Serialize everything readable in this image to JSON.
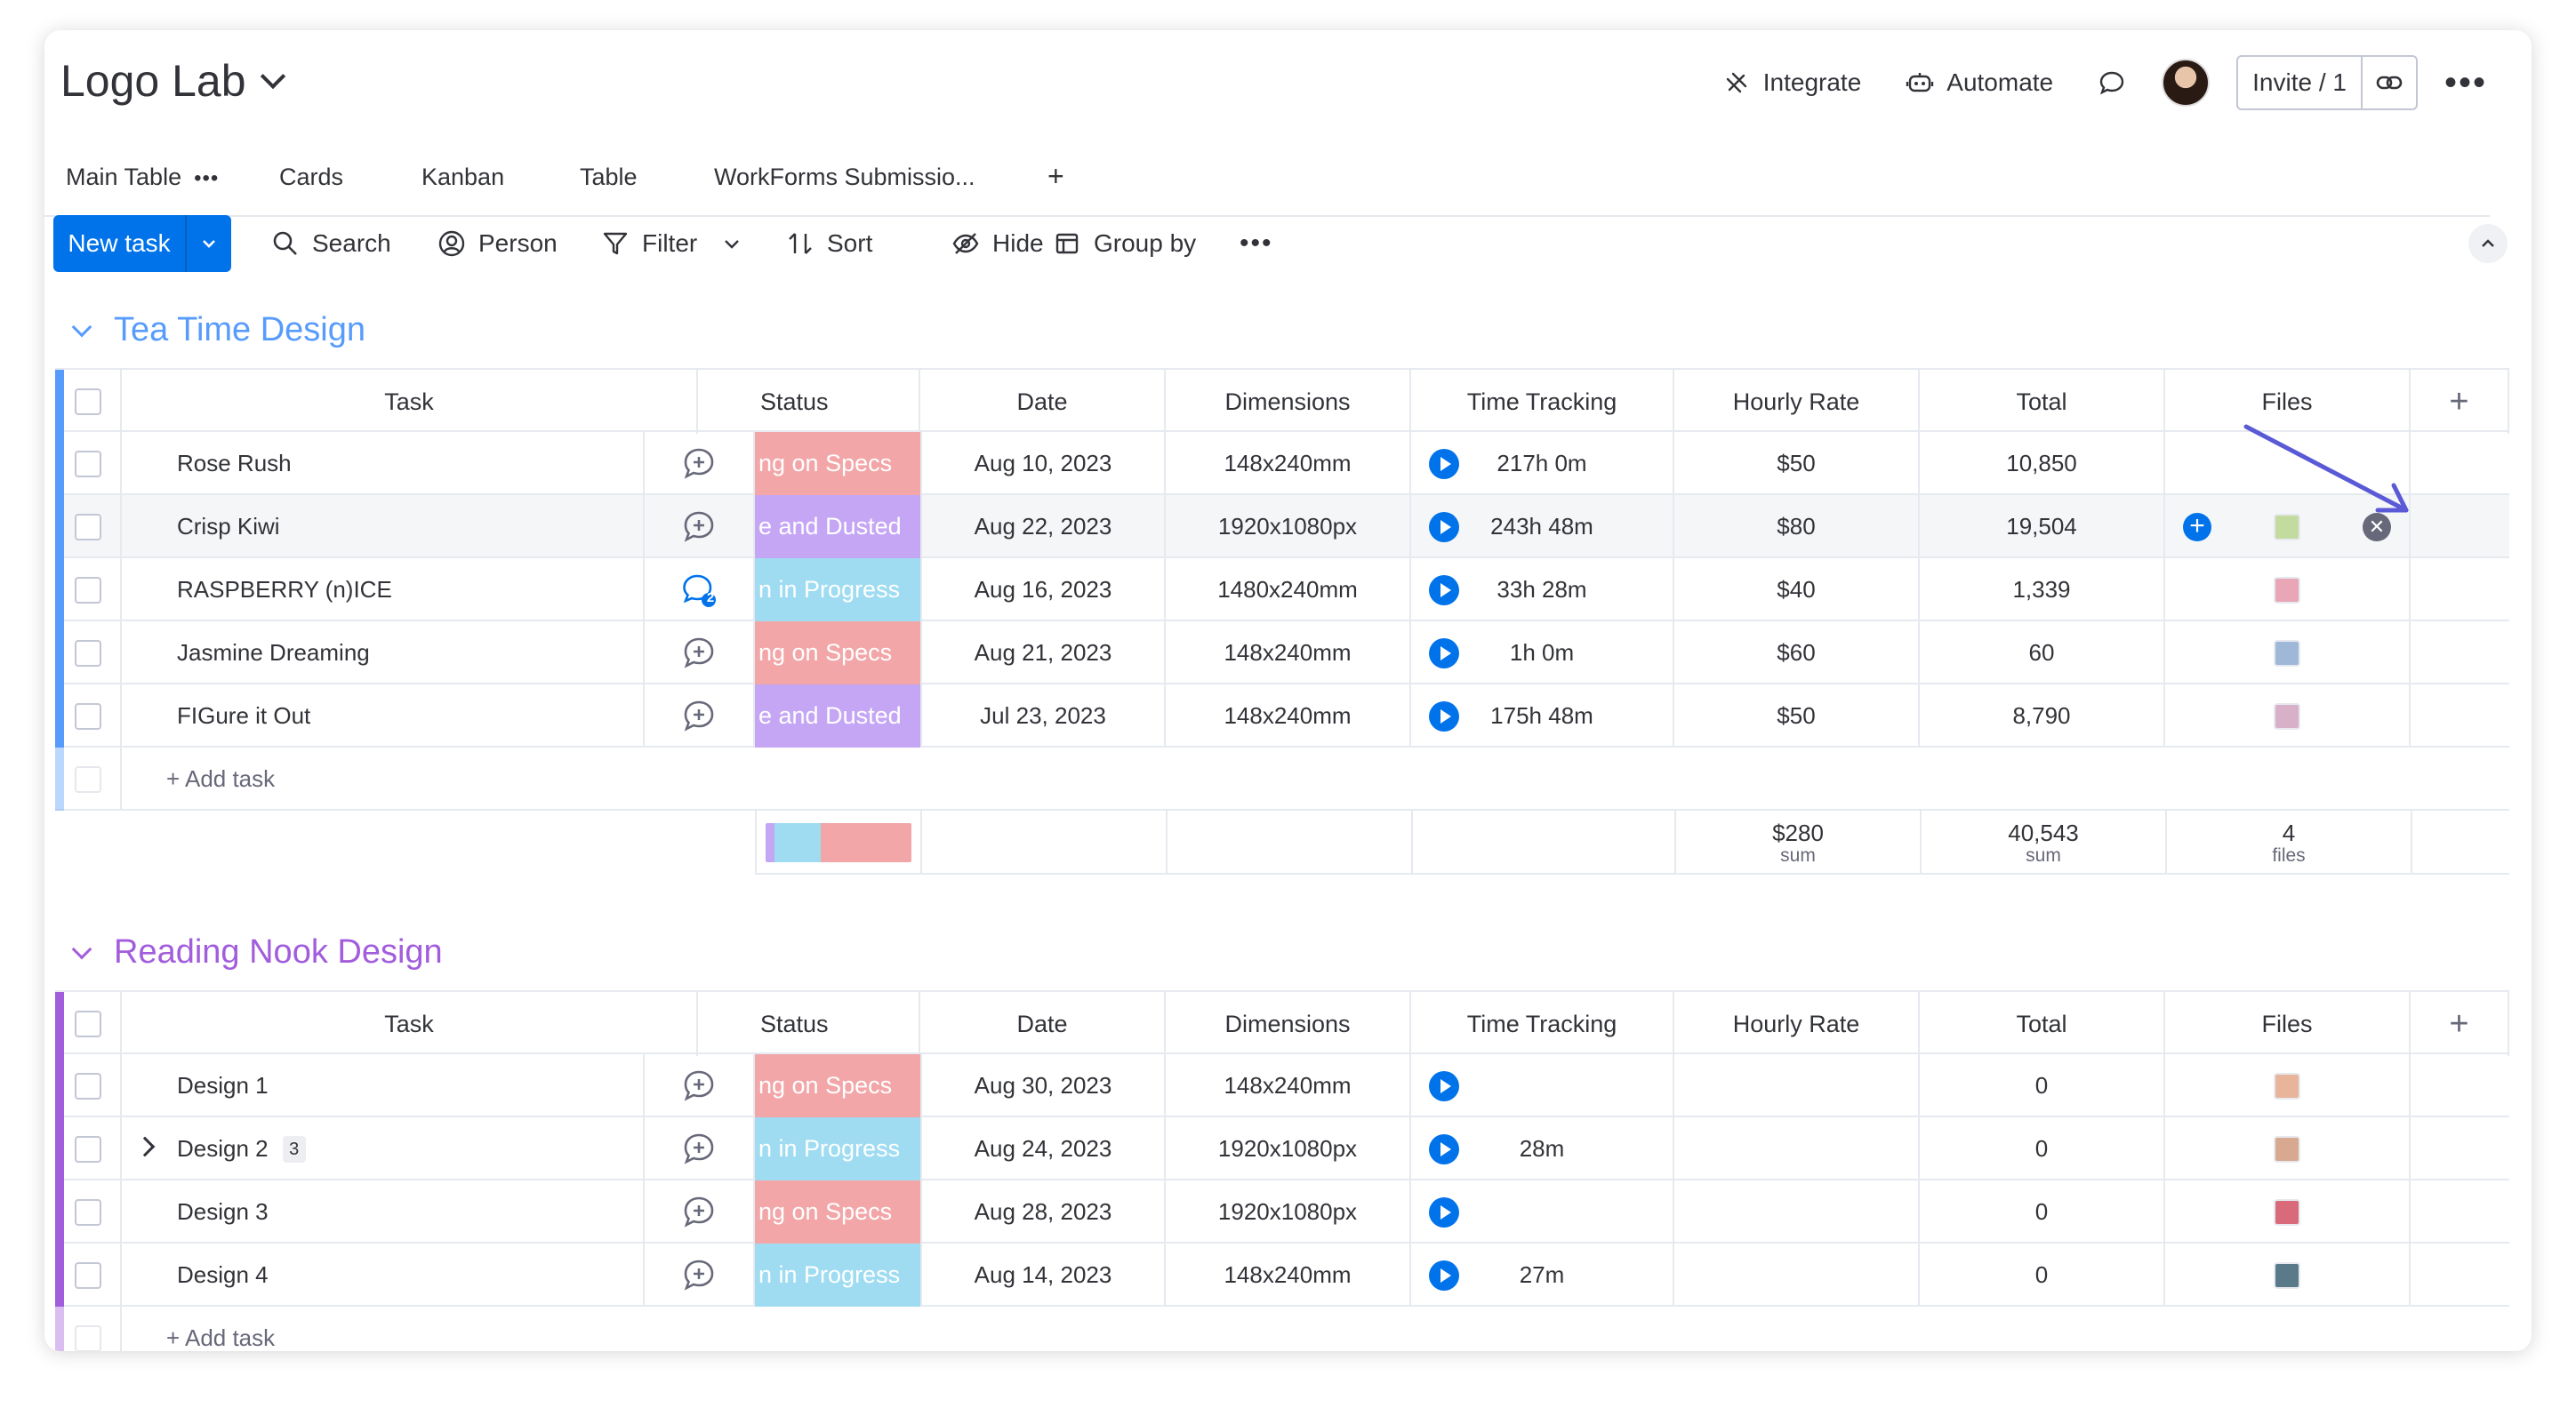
{
  "board": {
    "title": "Logo Lab"
  },
  "header": {
    "integrate": "Integrate",
    "automate": "Automate",
    "invite": "Invite / 1"
  },
  "tabs": [
    "Main Table",
    "Cards",
    "Kanban",
    "Table",
    "WorkForms Submissio...",
    "+"
  ],
  "toolbar": {
    "new_task": "New task",
    "search": "Search",
    "person": "Person",
    "filter": "Filter",
    "sort": "Sort",
    "hide": "Hide",
    "group_by": "Group by"
  },
  "columns": [
    "Task",
    "Status",
    "Date",
    "Dimensions",
    "Time Tracking",
    "Hourly Rate",
    "Total",
    "Files",
    "+"
  ],
  "colors": {
    "accent": "#0073ea",
    "group1": "#579bfc",
    "group2": "#a25ddc",
    "status_specs": "#f2a6a8",
    "status_dusted": "#c5a6f5",
    "status_progress": "#9fdcf1",
    "arrow": "#5b5ad6"
  },
  "groups": [
    {
      "title": "Tea Time Design",
      "add_task": "+ Add task",
      "rows": [
        {
          "task": "Rose Rush",
          "status": "ng on Specs",
          "status_color": "#f2a6a8",
          "date": "Aug 10, 2023",
          "dimensions": "148x240mm",
          "time": "217h 0m",
          "rate": "$50",
          "total": "10,850",
          "file_color": "#ffffff",
          "comments": ""
        },
        {
          "task": "Crisp Kiwi",
          "status": "e and Dusted",
          "status_color": "#c5a6f5",
          "date": "Aug 22, 2023",
          "dimensions": "1920x1080px",
          "time": "243h 48m",
          "rate": "$80",
          "total": "19,504",
          "file_color": "#c4dba0",
          "comments": ""
        },
        {
          "task": "RASPBERRY (n)ICE",
          "status": "n in Progress",
          "status_color": "#9fdcf1",
          "date": "Aug 16, 2023",
          "dimensions": "1480x240mm",
          "time": "33h 28m",
          "rate": "$40",
          "total": "1,339",
          "file_color": "#e8a6b6",
          "comments": "2"
        },
        {
          "task": "Jasmine Dreaming",
          "status": "ng on Specs",
          "status_color": "#f2a6a8",
          "date": "Aug 21, 2023",
          "dimensions": "148x240mm",
          "time": "1h 0m",
          "rate": "$60",
          "total": "60",
          "file_color": "#9fb8d8",
          "comments": ""
        },
        {
          "task": "FIGure it Out",
          "status": "e and Dusted",
          "status_color": "#c5a6f5",
          "date": "Jul 23, 2023",
          "dimensions": "148x240mm",
          "time": "175h 48m",
          "rate": "$50",
          "total": "8,790",
          "file_color": "#d8b0c8",
          "comments": ""
        }
      ],
      "summary": {
        "rate": "$280",
        "rate_label": "sum",
        "total": "40,543",
        "total_label": "sum",
        "files": "4",
        "files_label": "files"
      }
    },
    {
      "title": "Reading Nook Design",
      "add_task": "+ Add task",
      "rows": [
        {
          "task": "Design 1",
          "subitems": "",
          "status": "ng on Specs",
          "status_color": "#f2a6a8",
          "date": "Aug 30, 2023",
          "dimensions": "148x240mm",
          "time": "",
          "rate": "",
          "total": "0",
          "file_color": "#e8b49a"
        },
        {
          "task": "Design 2",
          "subitems": "3",
          "status": "n in Progress",
          "status_color": "#9fdcf1",
          "date": "Aug 24, 2023",
          "dimensions": "1920x1080px",
          "time": "28m",
          "rate": "",
          "total": "0",
          "file_color": "#d8a890"
        },
        {
          "task": "Design 3",
          "subitems": "",
          "status": "ng on Specs",
          "status_color": "#f2a6a8",
          "date": "Aug 28, 2023",
          "dimensions": "1920x1080px",
          "time": "",
          "rate": "",
          "total": "0",
          "file_color": "#d86a7a"
        },
        {
          "task": "Design 4",
          "subitems": "",
          "status": "n in Progress",
          "status_color": "#9fdcf1",
          "date": "Aug 14, 2023",
          "dimensions": "148x240mm",
          "time": "27m",
          "rate": "",
          "total": "0",
          "file_color": "#5a7a8a"
        }
      ]
    }
  ]
}
